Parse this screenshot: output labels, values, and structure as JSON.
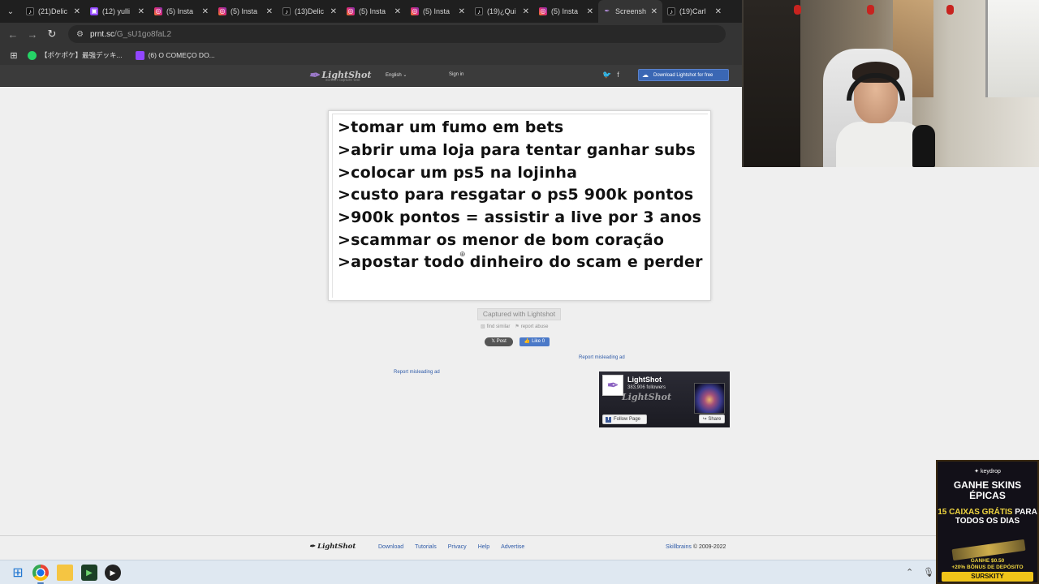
{
  "browser": {
    "tabs": [
      {
        "title": "(21)Delic",
        "icon": "tiktok-icon",
        "type": "tt"
      },
      {
        "title": "(12) yulli",
        "icon": "twitch-icon",
        "type": "tw"
      },
      {
        "title": "(5) Insta",
        "icon": "instagram-icon",
        "type": "ig"
      },
      {
        "title": "(5) Insta",
        "icon": "instagram-icon",
        "type": "ig"
      },
      {
        "title": "(13)Delic",
        "icon": "tiktok-icon",
        "type": "tt"
      },
      {
        "title": "(5) Insta",
        "icon": "instagram-icon",
        "type": "ig"
      },
      {
        "title": "(5) Insta",
        "icon": "instagram-icon",
        "type": "ig"
      },
      {
        "title": "(19)¿Qui",
        "icon": "tiktok-icon",
        "type": "tt"
      },
      {
        "title": "(5) Insta",
        "icon": "instagram-icon",
        "type": "ig"
      },
      {
        "title": "Screensh",
        "icon": "lightshot-icon",
        "type": "ls",
        "active": true
      },
      {
        "title": "(19)Carl",
        "icon": "tiktok-icon",
        "type": "tt"
      }
    ],
    "address": {
      "host": "prnt.sc",
      "path": "/G_sU1go8faL2"
    },
    "bookmarks": [
      {
        "label": "【ポケポケ】最強デッキ...",
        "icon": "whatsapp-icon"
      },
      {
        "label": "(6) O COMEÇO DO...",
        "icon": "twitch-icon"
      }
    ]
  },
  "lightshot_header": {
    "logo": "LightShot",
    "logo_sub": "screen capture tool",
    "language": "English",
    "sign_in": "Sign in",
    "download_button": "Download Lightshot for free"
  },
  "screenshot": {
    "lines": [
      ">tomar um fumo em bets",
      ">abrir uma loja para tentar ganhar subs",
      ">colocar um ps5 na lojinha",
      ">custo para resgatar o ps5 900k pontos",
      ">900k pontos = assistir a live por 3 anos",
      ">scammar os menor de bom coração",
      ">apostar todo dinheiro do scam e perder"
    ]
  },
  "below_image": {
    "captured": "Captured with Lightshot",
    "find_similar": "find similar",
    "report_abuse": "report abuse",
    "post_label": "Post",
    "like_label": "Like 0",
    "report_misleading_1": "Report misleading ad",
    "report_misleading_2": "Report misleading ad"
  },
  "fb_widget": {
    "name": "LightShot",
    "followers": "383,906 followers",
    "follow": "Follow Page",
    "share": "Share"
  },
  "footer": {
    "logo": "LightShot",
    "links": [
      "Download",
      "Tutorials",
      "Privacy",
      "Help",
      "Advertise"
    ],
    "company": "Skillbrains",
    "copyright": "© 2009-2022"
  },
  "ad": {
    "brand": "keydrop",
    "headline": "GANHE SKINS ÉPICAS",
    "sub_a": "15 CAIXAS GRÁTIS",
    "sub_b": "PARA TODOS OS DIAS",
    "promo_a": "GANHE $0.50",
    "promo_b": "+20% BÔNUS DE DEPÓSITO",
    "code": "SURSKITY"
  }
}
